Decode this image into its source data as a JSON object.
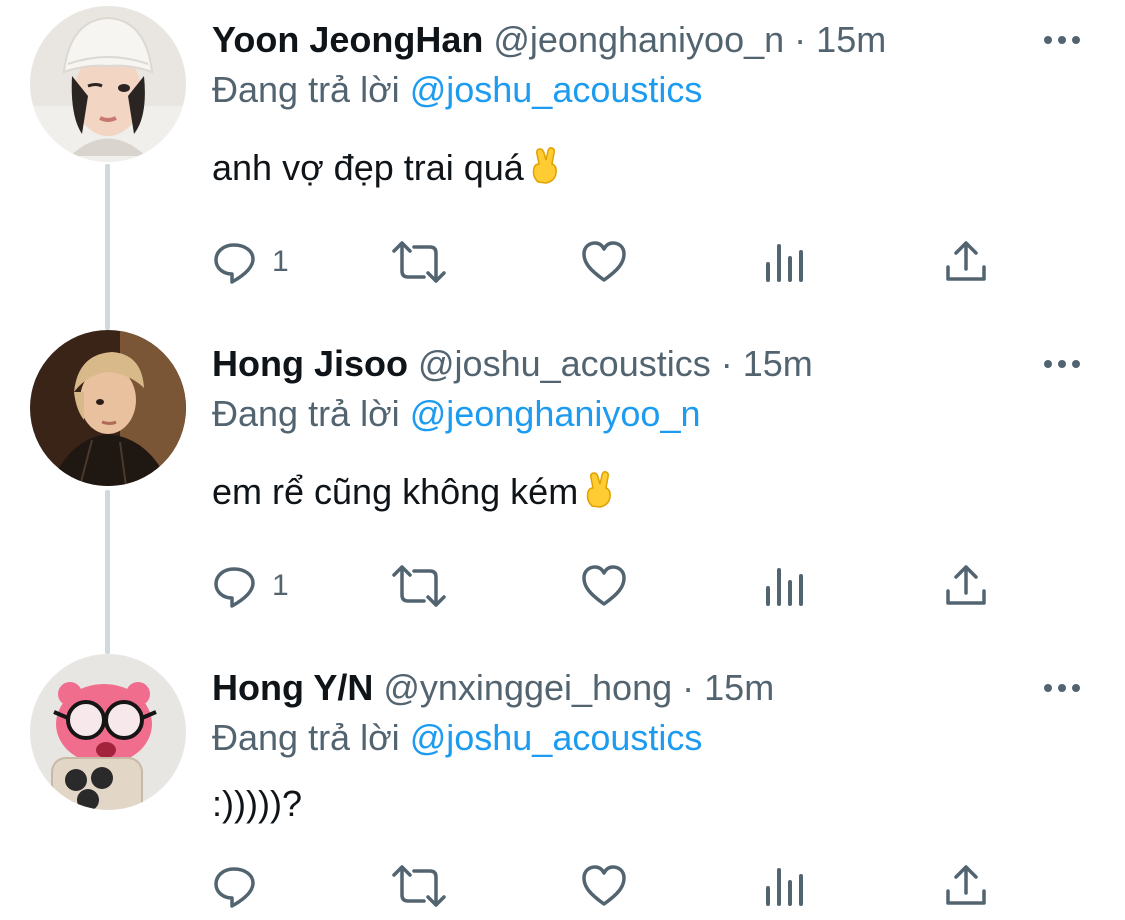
{
  "reply_prefix": "Đang trả lời",
  "tweets": [
    {
      "name": "Yoon JeongHan",
      "handle": "@jeonghaniyoo_n",
      "separator": "·",
      "time": "15m",
      "reply_to": "@joshu_acoustics",
      "text": "anh vợ đẹp trai quá",
      "reply_count": "1",
      "retweet_count": "",
      "like_count": "",
      "avatar_icon": "avatar-white-beanie"
    },
    {
      "name": "Hong Jisoo",
      "handle": "@joshu_acoustics",
      "separator": "·",
      "time": "15m",
      "reply_to": "@jeonghaniyoo_n",
      "text": "em rể cũng không kém",
      "reply_count": "1",
      "retweet_count": "",
      "like_count": "",
      "avatar_icon": "avatar-blonde-dark"
    },
    {
      "name": "Hong Y/N",
      "handle": "@ynxinggei_hong",
      "separator": "·",
      "time": "15m",
      "reply_to": "@joshu_acoustics",
      "text": ":)))))?",
      "reply_count": "",
      "retweet_count": "",
      "like_count": "",
      "avatar_icon": "avatar-pink-plush-glasses"
    }
  ],
  "colors": {
    "text_primary": "#0f1419",
    "text_secondary": "#536471",
    "mention": "#1d9bf0",
    "thread_line": "#cfd9de"
  },
  "icons": [
    "reply-icon",
    "retweet-icon",
    "like-icon",
    "analytics-icon",
    "share-icon",
    "more-icon",
    "crossed-fingers-emoji"
  ]
}
